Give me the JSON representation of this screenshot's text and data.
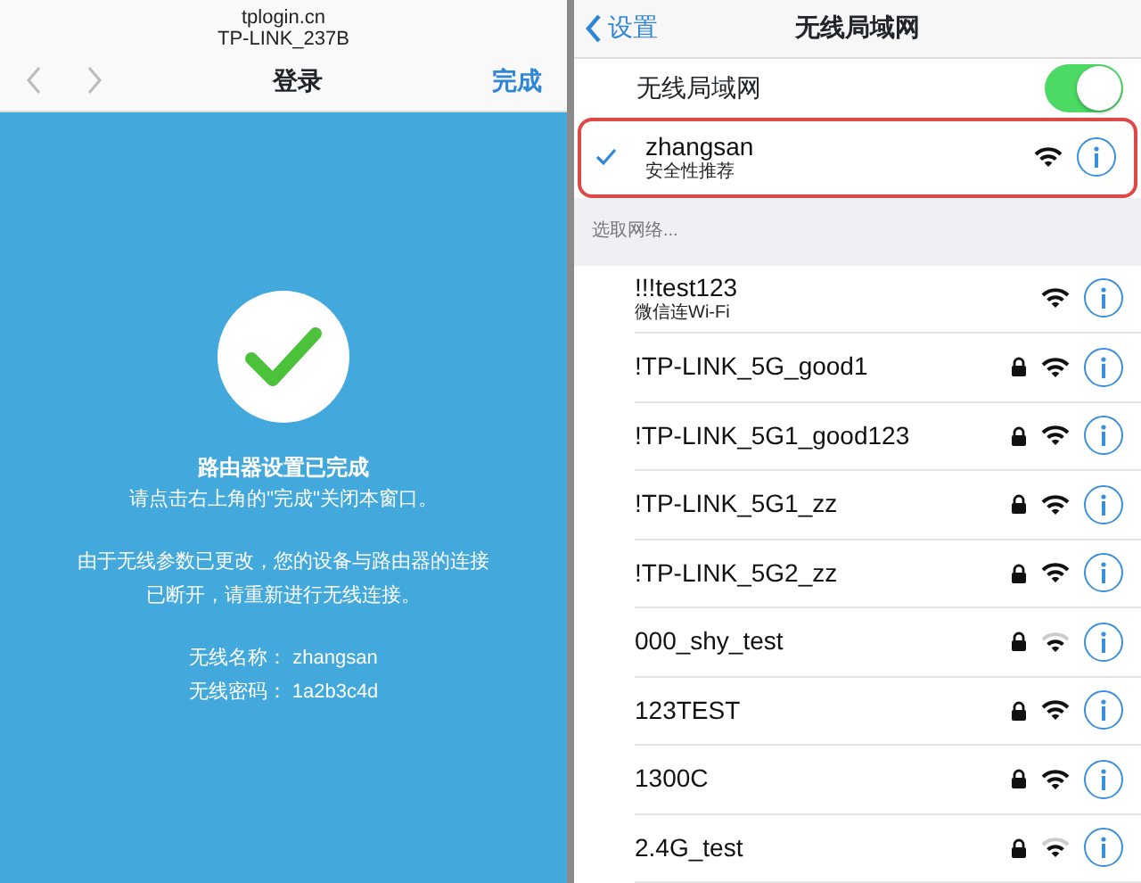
{
  "router_page": {
    "url": "tplogin.cn",
    "device": "TP-LINK_237B",
    "title": "登录",
    "done_button": "完成",
    "status_title": "路由器设置已完成",
    "instruction": "请点击右上角的\"完成\"关闭本窗口。",
    "notice": "由于无线参数已更改，您的设备与路由器的连接已断开，请重新进行无线连接。",
    "details": [
      {
        "label": "无线名称：",
        "value": "zhangsan"
      },
      {
        "label": "无线密码：",
        "value": "1a2b3c4d"
      }
    ]
  },
  "wifi_settings": {
    "back_label": "设置",
    "title": "无线局域网",
    "wifi_toggle": {
      "label": "无线局域网",
      "on": true
    },
    "connected": {
      "name": "zhangsan",
      "subtitle": "安全性推荐",
      "highlighted": true
    },
    "section_header": "选取网络...",
    "networks": [
      {
        "name": "!!!test123",
        "subtitle": "微信连Wi-Fi",
        "locked": false,
        "weak_signal": false
      },
      {
        "name": "!TP-LINK_5G_good1",
        "locked": true,
        "weak_signal": false
      },
      {
        "name": "!TP-LINK_5G1_good123",
        "locked": true,
        "weak_signal": false
      },
      {
        "name": "!TP-LINK_5G1_zz",
        "locked": true,
        "weak_signal": false
      },
      {
        "name": "!TP-LINK_5G2_zz",
        "locked": true,
        "weak_signal": false
      },
      {
        "name": "000_shy_test",
        "locked": true,
        "weak_signal": true
      },
      {
        "name": "123TEST",
        "locked": true,
        "weak_signal": false
      },
      {
        "name": "1300C",
        "locked": true,
        "weak_signal": false
      },
      {
        "name": "2.4G_test",
        "locked": true,
        "weak_signal": true
      }
    ]
  }
}
